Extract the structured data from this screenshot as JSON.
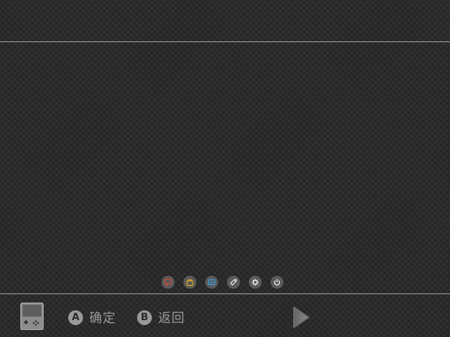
{
  "dock": {
    "items": [
      {
        "icon": "message-icon",
        "color": "#c0392b"
      },
      {
        "icon": "bag-icon",
        "color": "#d4a017"
      },
      {
        "icon": "cast-icon",
        "color": "#2e86c1"
      },
      {
        "icon": "tag-icon",
        "color": "#ffffff"
      },
      {
        "icon": "gear-icon",
        "color": "#ffffff"
      },
      {
        "icon": "power-icon",
        "color": "#ffffff"
      }
    ]
  },
  "footer": {
    "device_icon": "handheld-console-icon",
    "hint_a_key": "A",
    "hint_a_label": "确定",
    "hint_b_key": "B",
    "hint_b_label": "返回",
    "next_icon": "arrow-right-icon"
  }
}
